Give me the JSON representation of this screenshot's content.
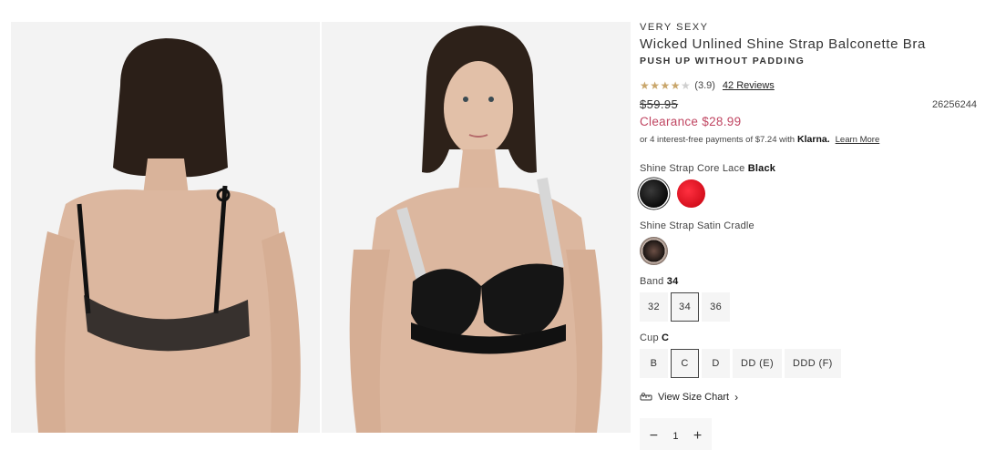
{
  "product": {
    "brand": "VERY SEXY",
    "title": "Wicked Unlined Shine Strap Balconette Bra",
    "subtitle": "PUSH UP WITHOUT PADDING",
    "rating": {
      "stars_filled": 4,
      "stars_total": 5,
      "value_text": "(3.9)",
      "reviews_link": "42 Reviews"
    },
    "original_price": "$59.95",
    "sku": "26256244",
    "sale_price": "Clearance $28.99",
    "klarna": {
      "text": "or 4 interest-free payments of $7.24 with",
      "logo": "Klarna.",
      "learn_more": "Learn More"
    }
  },
  "color_group_1": {
    "label": "Shine Strap Core Lace",
    "selected_value": "Black",
    "swatches": [
      {
        "name": "Black",
        "color": "#111111",
        "selected": true
      },
      {
        "name": "Red",
        "color": "#e0101f",
        "selected": false
      }
    ]
  },
  "color_group_2": {
    "label": "Shine Strap Satin Cradle"
  },
  "band": {
    "label": "Band",
    "selected_value": "34",
    "options": [
      "32",
      "34",
      "36"
    ]
  },
  "cup": {
    "label": "Cup",
    "selected_value": "C",
    "options": [
      "B",
      "C",
      "D",
      "DD (E)",
      "DDD (F)"
    ]
  },
  "size_chart_link": "View Size Chart",
  "quantity": {
    "value": "1",
    "minus": "−",
    "plus": "+"
  },
  "icons": {
    "size_chart": "ruler-icon",
    "chevron": "chevron-right-icon"
  }
}
